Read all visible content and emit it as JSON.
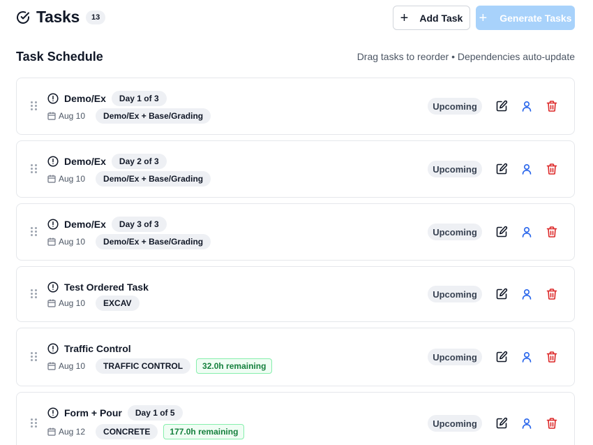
{
  "header": {
    "title": "Tasks",
    "count": "13",
    "add_label": "Add Task",
    "generate_label": "Generate Tasks",
    "icon": "check-circle-icon"
  },
  "section": {
    "title": "Task Schedule",
    "hint": "Drag tasks to reorder • Dependencies auto-update"
  },
  "colors": {
    "primary_disabled": "#a8d2fb",
    "user_icon": "#2563eb",
    "delete_icon": "#dc2626",
    "remaining_text": "#15803d",
    "remaining_border": "#86efac"
  },
  "tasks": [
    {
      "name": "Demo/Ex",
      "day": "Day 1 of 3",
      "date": "Aug 10",
      "trade": "Demo/Ex + Base/Grading",
      "remaining": "",
      "status": "Upcoming"
    },
    {
      "name": "Demo/Ex",
      "day": "Day 2 of 3",
      "date": "Aug 10",
      "trade": "Demo/Ex + Base/Grading",
      "remaining": "",
      "status": "Upcoming"
    },
    {
      "name": "Demo/Ex",
      "day": "Day 3 of 3",
      "date": "Aug 10",
      "trade": "Demo/Ex + Base/Grading",
      "remaining": "",
      "status": "Upcoming"
    },
    {
      "name": "Test Ordered Task",
      "day": "",
      "date": "Aug 10",
      "trade": "EXCAV",
      "remaining": "",
      "status": "Upcoming"
    },
    {
      "name": "Traffic Control",
      "day": "",
      "date": "Aug 10",
      "trade": "TRAFFIC CONTROL",
      "remaining": "32.0h remaining",
      "status": "Upcoming"
    },
    {
      "name": "Form + Pour",
      "day": "Day 1 of 5",
      "date": "Aug 12",
      "trade": "CONCRETE",
      "remaining": "177.0h remaining",
      "status": "Upcoming"
    }
  ]
}
